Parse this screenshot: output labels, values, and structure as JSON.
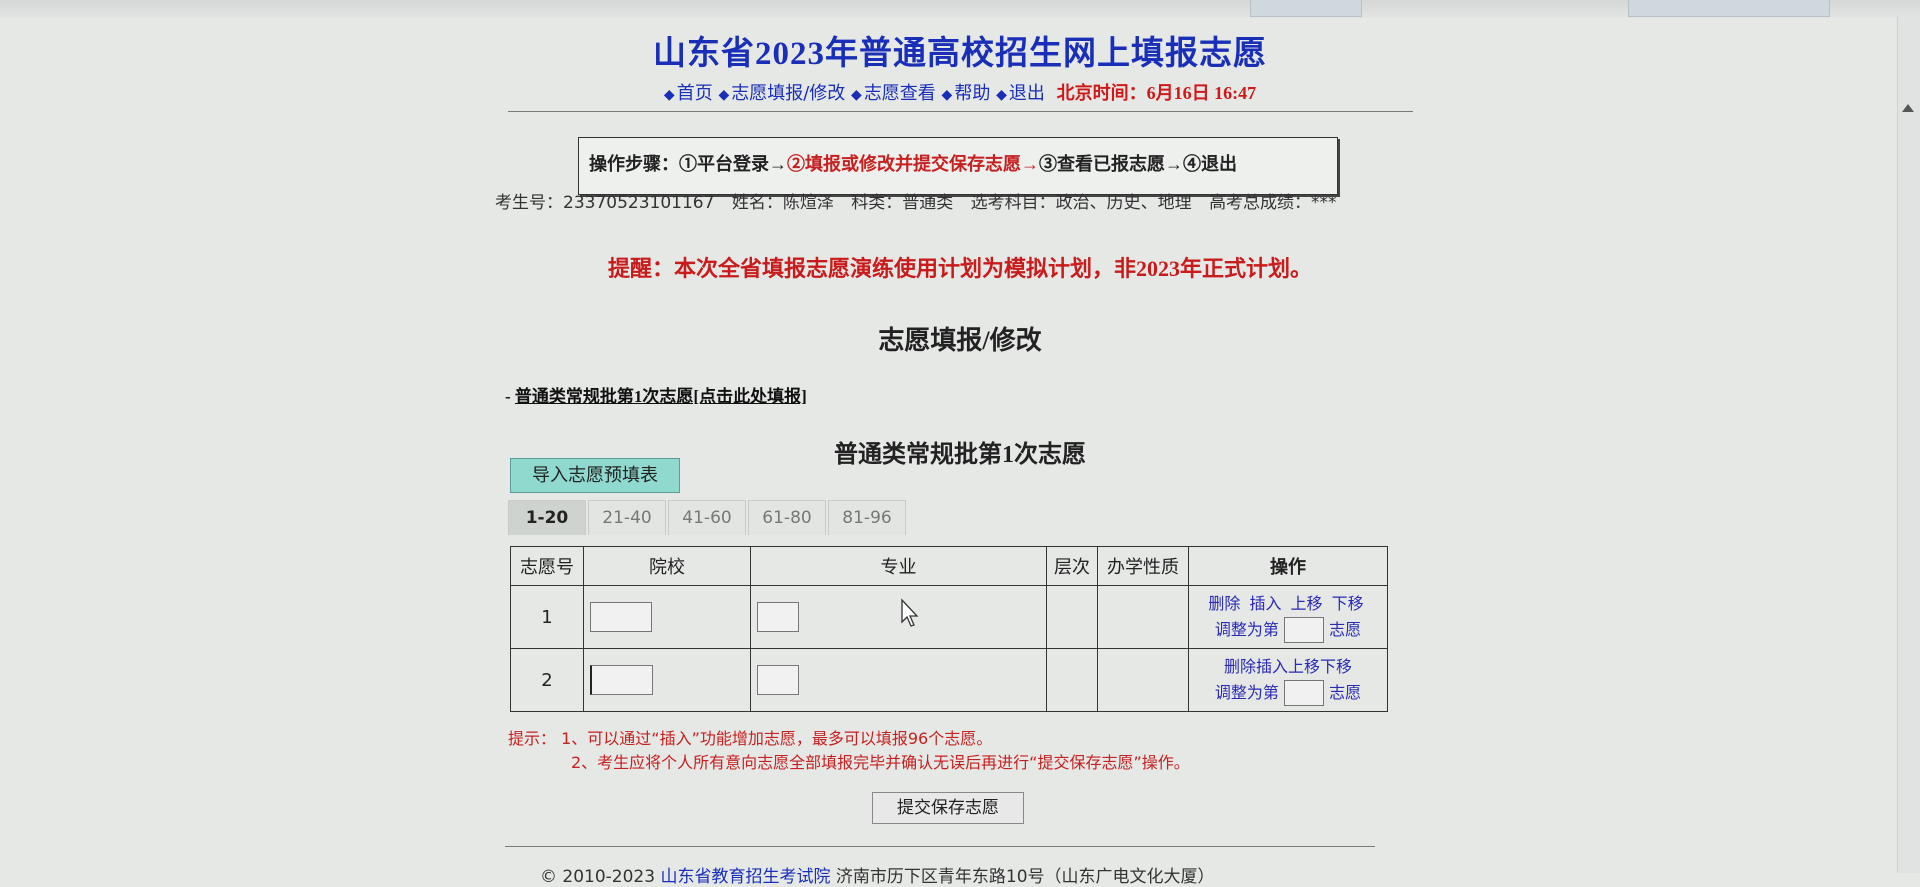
{
  "header": {
    "title": "山东省2023年普通高校招生网上填报志愿",
    "nav": [
      {
        "label": "首页"
      },
      {
        "label": "志愿填报/修改"
      },
      {
        "label": "志愿查看"
      },
      {
        "label": "帮助"
      },
      {
        "label": "退出"
      }
    ],
    "clock_label": "北京时间：6月16日 16:47"
  },
  "steps": {
    "prefix": "操作步骤：",
    "step1": "①平台登录→",
    "step2": "②填报或修改并提交保存志愿→",
    "step3": "③查看已报志愿→",
    "step4": "④退出"
  },
  "student": {
    "id": "考生号：23370523101167",
    "name": "姓名：陈煊泽",
    "category": "科类：普通类",
    "subjects": "选考科目：政治、历史、地理",
    "score": "高考总成绩：***"
  },
  "reminder": "提醒：本次全省填报志愿演练使用计划为模拟计划，非2023年正式计划。",
  "section_title": "志愿填报/修改",
  "batch_link": {
    "prefix": "- ",
    "text": "普通类常规批第1次志愿[点击此处填报]"
  },
  "form_title": "普通类常规批第1次志愿",
  "import_button": "导入志愿预填表",
  "tabs": [
    "1-20",
    "21-40",
    "41-60",
    "61-80",
    "81-96"
  ],
  "table": {
    "headers": [
      "志愿号",
      "院校",
      "专业",
      "层次",
      "办学性质",
      "操作"
    ],
    "rows": [
      {
        "no": "1",
        "ops": [
          "删除",
          "插入",
          "上移",
          "下移"
        ],
        "adjust_prefix": "调整为第",
        "adjust_suffix": "志愿"
      },
      {
        "no": "2",
        "ops": [
          "删除",
          "插入",
          "上移",
          "下移"
        ],
        "adjust_prefix": "调整为第",
        "adjust_suffix": "志愿"
      }
    ]
  },
  "tips": {
    "label": "提示：",
    "line1": "1、可以通过“插入”功能增加志愿，最多可以填报96个志愿。",
    "line2": "2、考生应将个人所有意向志愿全部填报完毕并确认无误后再进行“提交保存志愿”操作。"
  },
  "submit_button": "提交保存志愿",
  "footer": {
    "prefix": "© 2010-2023 ",
    "org": "山东省教育招生考试院",
    "address": " 济南市历下区青年东路10号（山东广电文化大厦）"
  },
  "colors": {
    "title_blue": "#1a2fb8",
    "alert_red": "#c91b1b",
    "import_button_bg": "#8fd9cf",
    "link_blue": "#2a2ab4"
  }
}
